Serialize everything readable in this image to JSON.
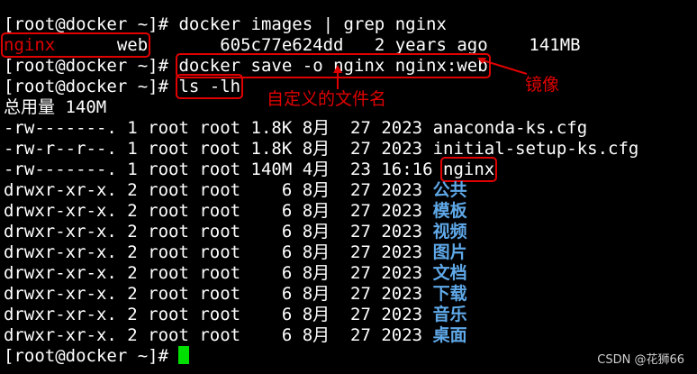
{
  "terminal": {
    "prompt": "[root@docker ~]#",
    "lines": {
      "l0": {
        "prompt": "[root@docker ~]#",
        "cmd": " docker images | grep nginx"
      },
      "l1": {
        "repo": "nginx",
        "tag_field": "      web",
        "rest": "       605c77e624dd   2 years ago    141MB"
      },
      "l2": {
        "prompt": "[root@docker ~]#",
        "cmd": "docker save -o nginx nginx:web"
      },
      "l3": {
        "prompt": "[root@docker ~]#",
        "cmd": "ls -lh"
      },
      "l4": {
        "text": "总用量 140M"
      }
    },
    "files": [
      {
        "meta": "-rw-------. 1 root root 1.8K 8月  27 2023 ",
        "name": "anaconda-ks.cfg"
      },
      {
        "meta": "-rw-r--r--. 1 root root 1.8K 8月  27 2023 ",
        "name": "initial-setup-ks.cfg"
      },
      {
        "meta": "-rw-------. 1 root root 140M 4月  23 16:16 ",
        "name": "nginx"
      },
      {
        "meta": "drwxr-xr-x. 2 root root    6 8月  27 2023 ",
        "name": "公共"
      },
      {
        "meta": "drwxr-xr-x. 2 root root    6 8月  27 2023 ",
        "name": "模板"
      },
      {
        "meta": "drwxr-xr-x. 2 root root    6 8月  27 2023 ",
        "name": "视频"
      },
      {
        "meta": "drwxr-xr-x. 2 root root    6 8月  27 2023 ",
        "name": "图片"
      },
      {
        "meta": "drwxr-xr-x. 2 root root    6 8月  27 2023 ",
        "name": "文档"
      },
      {
        "meta": "drwxr-xr-x. 2 root root    6 8月  27 2023 ",
        "name": "下载"
      },
      {
        "meta": "drwxr-xr-x. 2 root root    6 8月  27 2023 ",
        "name": "音乐"
      },
      {
        "meta": "drwxr-xr-x. 2 root root    6 8月  27 2023 ",
        "name": "桌面"
      }
    ],
    "final_prompt": "[root@docker ~]#"
  },
  "annotations": {
    "mirror": "镜像",
    "custom_filename": "自定义的文件名"
  },
  "watermark": "CSDN @花狮66",
  "colors": {
    "background": "#000000",
    "text": "#ffffff",
    "annotation": "#e00000",
    "directory": "#5fa8e8",
    "cursor": "#00e000"
  }
}
